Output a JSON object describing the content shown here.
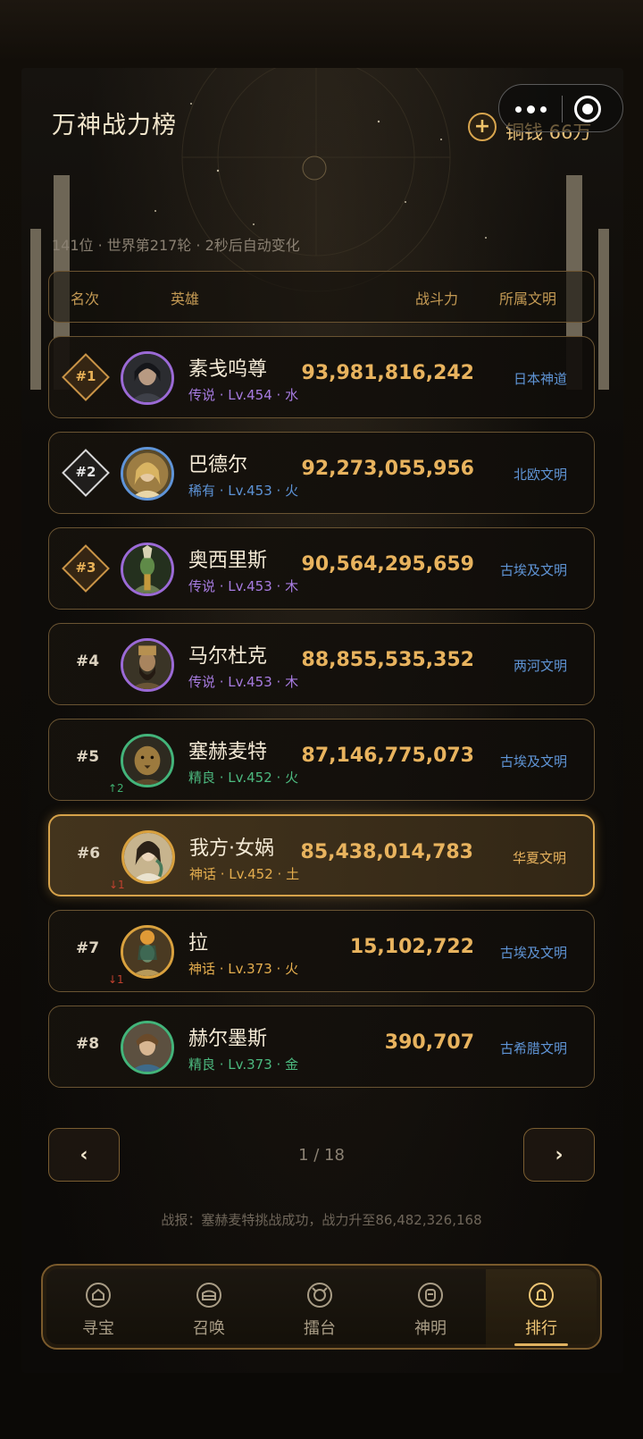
{
  "header": {
    "title": "万神战力榜",
    "coins": "铜钱 66万",
    "meta": "141位 · 世界第217轮 · 2秒后自动变化"
  },
  "columns": {
    "rank": "名次",
    "hero": "英雄",
    "power": "战斗力",
    "civ": "所属文明"
  },
  "rows": [
    {
      "rank": "#1",
      "badge": "gold",
      "name": "素戋呜尊",
      "sub": "传说 · Lv.454 · 水",
      "tier": "legend",
      "power": "93,981,816,242",
      "civ": "日本神道",
      "move": ""
    },
    {
      "rank": "#2",
      "badge": "silver",
      "name": "巴德尔",
      "sub": "稀有 · Lv.453 · 火",
      "tier": "rare",
      "power": "92,273,055,956",
      "civ": "北欧文明",
      "move": ""
    },
    {
      "rank": "#3",
      "badge": "gold",
      "name": "奥西里斯",
      "sub": "传说 · Lv.453 · 木",
      "tier": "legend",
      "power": "90,564,295,659",
      "civ": "古埃及文明",
      "move": ""
    },
    {
      "rank": "#4",
      "badge": "",
      "name": "马尔杜克",
      "sub": "传说 · Lv.453 · 木",
      "tier": "legend",
      "power": "88,855,535,352",
      "civ": "两河文明",
      "move": ""
    },
    {
      "rank": "#5",
      "badge": "",
      "name": "塞赫麦特",
      "sub": "精良 · Lv.452 · 火",
      "tier": "elite",
      "power": "87,146,775,073",
      "civ": "古埃及文明",
      "move": "↑2"
    },
    {
      "rank": "#6",
      "badge": "",
      "name": "我方·女娲",
      "sub": "神话 · Lv.452 · 土",
      "tier": "myth",
      "power": "85,438,014,783",
      "civ": "华夏文明",
      "move": "↓1"
    },
    {
      "rank": "#7",
      "badge": "",
      "name": "拉",
      "sub": "神话 · Lv.373 · 火",
      "tier": "myth",
      "power": "15,102,722",
      "civ": "古埃及文明",
      "move": "↓1"
    },
    {
      "rank": "#8",
      "badge": "",
      "name": "赫尔墨斯",
      "sub": "精良 · Lv.373 · 金",
      "tier": "elite",
      "power": "390,707",
      "civ": "古希腊文明",
      "move": ""
    }
  ],
  "pager": {
    "prev": "‹",
    "next": "›",
    "text": "1 / 18"
  },
  "report": "战报：塞赫麦特挑战成功，战力升至86,482,326,168",
  "tabs": [
    {
      "label": "寻宝",
      "icon": "chest-icon"
    },
    {
      "label": "召唤",
      "icon": "summon-icon"
    },
    {
      "label": "擂台",
      "icon": "arena-icon"
    },
    {
      "label": "神明",
      "icon": "god-icon"
    },
    {
      "label": "排行",
      "icon": "rank-icon",
      "active": true
    }
  ],
  "colors": {
    "gold": "#e8b35e",
    "legend": "#a77be0",
    "rare": "#5d93d6",
    "elite": "#4cb97f",
    "myth": "#e4ad4e",
    "civ": "#5f95d6"
  }
}
